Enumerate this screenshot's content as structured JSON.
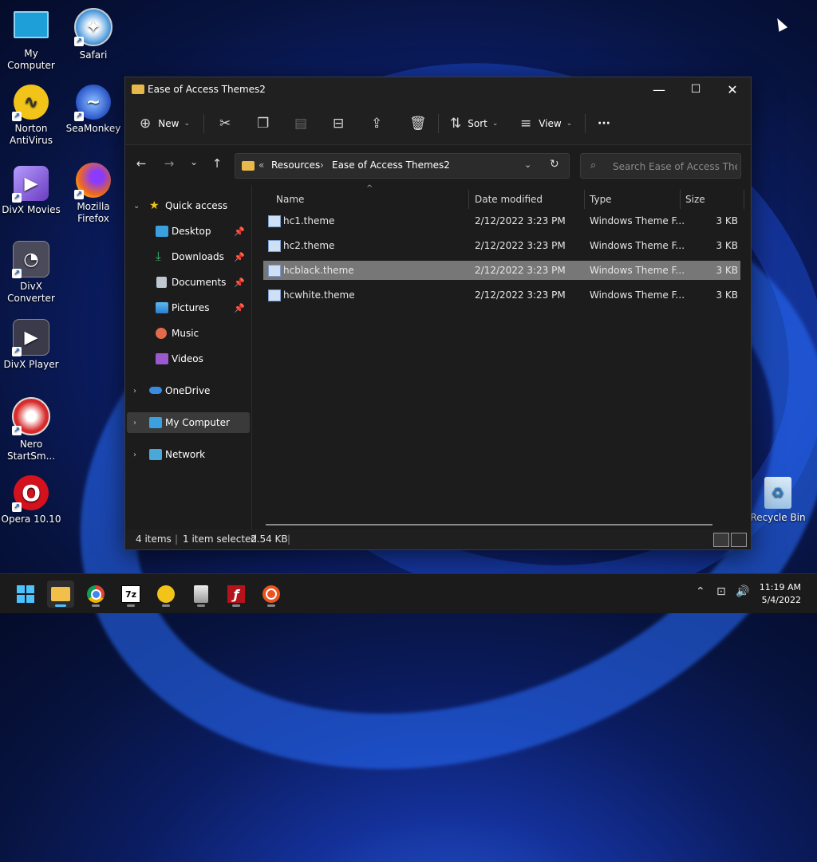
{
  "desktop_icons": [
    {
      "label": "My Computer",
      "icon": "monitor-icon",
      "color": "#1e9fd8"
    },
    {
      "label": "Safari",
      "icon": "compass-icon",
      "color": "#3b8fd8"
    },
    {
      "label": "Norton AntiVirus",
      "icon": "stethoscope-icon",
      "color": "#f2c318"
    },
    {
      "label": "SeaMonkey",
      "icon": "seamonkey-icon",
      "color": "#2b56c8"
    },
    {
      "label": "DivX Movies",
      "icon": "divx-movies-icon",
      "color": "#8a63d2"
    },
    {
      "label": "Mozilla Firefox",
      "icon": "firefox-icon",
      "color": "#f06a1c"
    },
    {
      "label": "DivX Converter",
      "icon": "divx-converter-icon",
      "color": "#4a4a5a"
    },
    {
      "label": "DivX Player",
      "icon": "divx-player-icon",
      "color": "#3a3a4a"
    },
    {
      "label": "Nero StartSm...",
      "icon": "nero-icon",
      "color": "#d72a2a"
    },
    {
      "label": "Opera 10.10",
      "icon": "opera-icon",
      "color": "#d4121e"
    },
    {
      "label": "Recycle Bin",
      "icon": "recycle-bin-icon",
      "color": "#9cc3e6"
    }
  ],
  "window": {
    "title": "Ease of Access Themes2",
    "minimize": "—",
    "maximize": "☐",
    "close": "✕"
  },
  "toolbar": {
    "new_label": "New",
    "sort_label": "Sort",
    "view_label": "View",
    "more": "···"
  },
  "address": {
    "overflow": "«",
    "crumbs": [
      "Resources",
      "Ease of Access Themes2"
    ],
    "separator": "›"
  },
  "search": {
    "placeholder": "Search Ease of Access Them..."
  },
  "sidebar": {
    "quick_access": "Quick access",
    "items": [
      {
        "label": "Desktop",
        "icon": "desktop-icon",
        "pinned": true
      },
      {
        "label": "Downloads",
        "icon": "downloads-icon",
        "pinned": true
      },
      {
        "label": "Documents",
        "icon": "documents-icon",
        "pinned": true
      },
      {
        "label": "Pictures",
        "icon": "pictures-icon",
        "pinned": true
      },
      {
        "label": "Music",
        "icon": "music-icon",
        "pinned": false
      },
      {
        "label": "Videos",
        "icon": "videos-icon",
        "pinned": false
      }
    ],
    "onedrive": "OneDrive",
    "my_computer": "My Computer",
    "network": "Network"
  },
  "columns": {
    "name": "Name",
    "date": "Date modified",
    "type": "Type",
    "size": "Size"
  },
  "files": [
    {
      "name": "hc1.theme",
      "date": "2/12/2022 3:23 PM",
      "type": "Windows Theme F...",
      "size": "3 KB",
      "selected": false
    },
    {
      "name": "hc2.theme",
      "date": "2/12/2022 3:23 PM",
      "type": "Windows Theme F...",
      "size": "3 KB",
      "selected": false
    },
    {
      "name": "hcblack.theme",
      "date": "2/12/2022 3:23 PM",
      "type": "Windows Theme F...",
      "size": "3 KB",
      "selected": true
    },
    {
      "name": "hcwhite.theme",
      "date": "2/12/2022 3:23 PM",
      "type": "Windows Theme F...",
      "size": "3 KB",
      "selected": false
    }
  ],
  "status": {
    "items": "4 items",
    "selected": "1 item selected",
    "size": "2.54 KB"
  },
  "taskbar": {
    "apps": [
      "start-icon",
      "file-explorer-icon",
      "chrome-icon",
      "7zip-icon",
      "norton-icon",
      "installer-icon",
      "flash-icon",
      "ubuntu-icon"
    ],
    "sevenzip_label": "7z",
    "time": "11:19 AM",
    "date": "5/4/2022"
  }
}
